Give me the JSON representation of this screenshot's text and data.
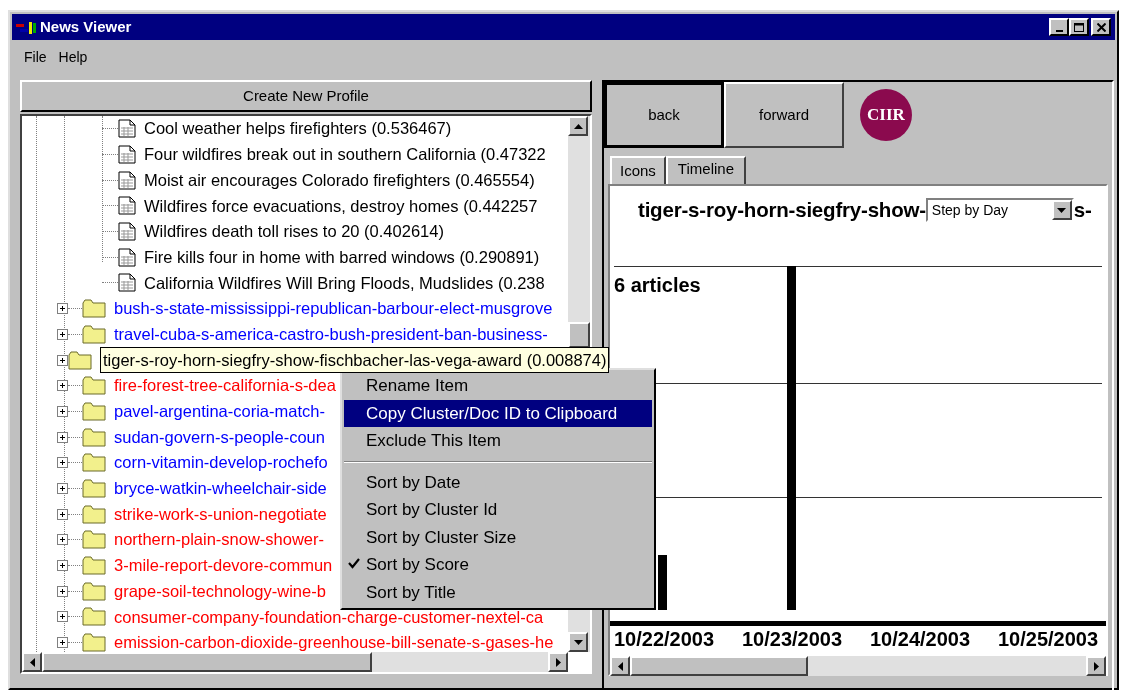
{
  "window": {
    "title": "News Viewer"
  },
  "menu_bar": [
    "File",
    "Help"
  ],
  "create_profile_button": "Create New Profile",
  "tree": {
    "documents": [
      {
        "label": "Cool weather helps firefighters (0.536467)"
      },
      {
        "label": "Four wildfires break out in southern California (0.47322"
      },
      {
        "label": "Moist air encourages Colorado firefighters (0.465554)"
      },
      {
        "label": "Wildfires force evacuations, destroy homes (0.442257"
      },
      {
        "label": "Wildfires death toll rises to 20 (0.402614)"
      },
      {
        "label": "Fire kills four in home with barred windows (0.290891)"
      },
      {
        "label": "California Wildfires Will Bring Floods, Mudslides (0.238"
      }
    ],
    "folders": [
      {
        "label": "bush-s-state-mississippi-republican-barbour-elect-musgrove",
        "color": "#0000ff",
        "expanded": false,
        "selected": false
      },
      {
        "label": "travel-cuba-s-america-castro-bush-president-ban-business-",
        "color": "#0000ff",
        "expanded": false,
        "selected": false
      },
      {
        "label": "tiger-s-roy-horn-siegfry-show-fischbacher-las-vega-award (0.008874)",
        "color": "#000000",
        "expanded": false,
        "selected": true
      },
      {
        "label": "fire-forest-tree-california-s-dea",
        "color": "#ff0000",
        "expanded": false,
        "selected": false
      },
      {
        "label": "pavel-argentina-coria-match-",
        "color": "#0000ff",
        "expanded": false,
        "selected": false
      },
      {
        "label": "sudan-govern-s-people-coun",
        "color": "#0000ff",
        "expanded": false,
        "selected": false
      },
      {
        "label": "corn-vitamin-develop-rochefo",
        "color": "#0000ff",
        "expanded": false,
        "selected": false
      },
      {
        "label": "bryce-watkin-wheelchair-side",
        "color": "#0000ff",
        "expanded": false,
        "selected": false
      },
      {
        "label": "strike-work-s-union-negotiate",
        "color": "#ff0000",
        "expanded": false,
        "selected": false
      },
      {
        "label": "northern-plain-snow-shower-",
        "color": "#ff0000",
        "expanded": false,
        "selected": false
      },
      {
        "label": "3-mile-report-devore-commun",
        "color": "#ff0000",
        "expanded": false,
        "selected": false
      },
      {
        "label": "grape-soil-technology-wine-b",
        "color": "#ff0000",
        "expanded": false,
        "selected": false
      },
      {
        "label": "consumer-company-foundation-charge-customer-nextel-ca",
        "color": "#ff0000",
        "expanded": false,
        "selected": false
      },
      {
        "label": "emission-carbon-dioxide-greenhouse-bill-senate-s-gases-he",
        "color": "#ff0000",
        "expanded": false,
        "selected": false
      }
    ]
  },
  "context_menu": [
    {
      "kind": "item",
      "label": "Rename Item",
      "selected": false,
      "checked": false
    },
    {
      "kind": "item",
      "label": "Copy Cluster/Doc ID to Clipboard",
      "selected": true,
      "checked": false
    },
    {
      "kind": "item",
      "label": "Exclude This Item",
      "selected": false,
      "checked": false
    },
    {
      "kind": "separator"
    },
    {
      "kind": "item",
      "label": "Sort by Date",
      "selected": false,
      "checked": false
    },
    {
      "kind": "item",
      "label": "Sort by Cluster Id",
      "selected": false,
      "checked": false
    },
    {
      "kind": "item",
      "label": "Sort by Cluster Size",
      "selected": false,
      "checked": false
    },
    {
      "kind": "item",
      "label": "Sort by Score",
      "selected": false,
      "checked": true
    },
    {
      "kind": "item",
      "label": "Sort by Title",
      "selected": false,
      "checked": false
    }
  ],
  "nav_buttons": [
    {
      "label": "back",
      "selected": true
    },
    {
      "label": "forward",
      "selected": false
    }
  ],
  "logo_text": "CIIR",
  "tabs": [
    {
      "label": "Icons",
      "selected": false
    },
    {
      "label": "Timeline",
      "selected": true
    }
  ],
  "timeline": {
    "title": "tiger-s-roy-horn-siegfry-show-",
    "step_select": "Step by Day",
    "title_tail": "s-",
    "count_label": "6 articles",
    "dates": [
      "10/22/2003",
      "10/23/2003",
      "10/24/2003",
      "10/25/2003"
    ]
  }
}
